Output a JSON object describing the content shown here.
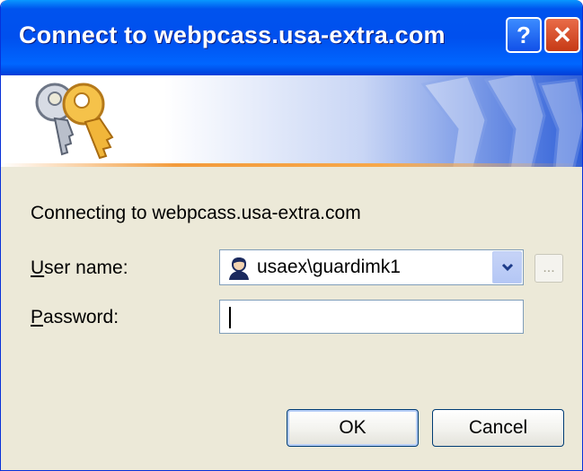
{
  "window": {
    "title": "Connect to webpcass.usa-extra.com"
  },
  "titlebar_buttons": {
    "help": "?",
    "close": "✕"
  },
  "icons": {
    "banner": "keys-icon",
    "user": "user-account-icon",
    "dropdown": "chevron-down-icon"
  },
  "message": "Connecting to webpcass.usa-extra.com",
  "user_name": {
    "label_accel": "U",
    "label_rest": "ser name:",
    "value": "usaex\\guardimk1",
    "browse": "..."
  },
  "password": {
    "label_accel": "P",
    "label_rest": "assword:",
    "value": ""
  },
  "buttons": {
    "ok": "OK",
    "cancel": "Cancel"
  },
  "colors": {
    "titlebar": "#0053ee",
    "dialog_bg": "#ece9d8",
    "accent_line": "#f39b3b"
  }
}
